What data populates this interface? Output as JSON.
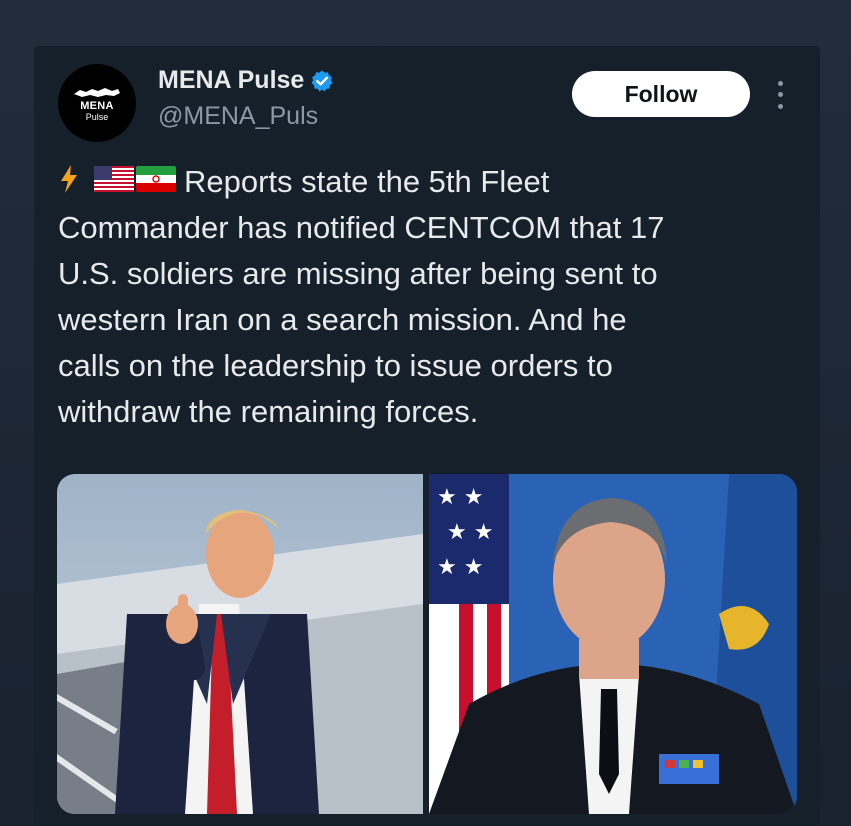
{
  "author": {
    "avatar_line1": "MENA",
    "avatar_line2": "Pulse",
    "display_name": "MENA Pulse",
    "handle": "@MENA_Puls",
    "verified": true
  },
  "actions": {
    "follow_label": "Follow"
  },
  "icons": {
    "verified": "verified-badge-icon",
    "more": "more-options-icon",
    "bolt": "lightning-emoji",
    "flag_us": "us-flag-emoji",
    "flag_iran": "iran-flag-emoji"
  },
  "tweet": {
    "text": "Reports state the 5th Fleet\nCommander has notified CENTCOM that 17\nU.S. soldiers are missing after being sent to\nwestern Iran on a search mission. And he\ncalls on the leadership to issue orders to\nwithdraw the remaining forces."
  },
  "colors": {
    "background": "#15202b",
    "verified": "#1d9bf0",
    "text": "#e7e9ea",
    "muted": "#8b98a5"
  }
}
